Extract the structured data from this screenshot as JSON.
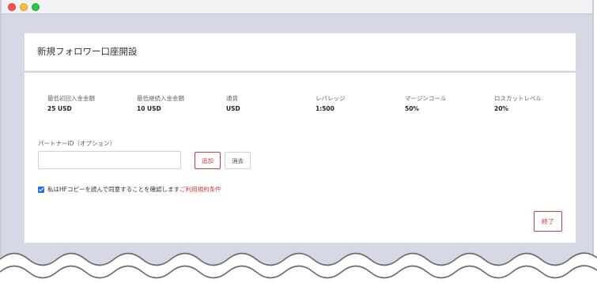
{
  "window": {
    "controls": [
      "close",
      "minimize",
      "maximize"
    ]
  },
  "card": {
    "title": "新規フォロワー口座開設"
  },
  "info": [
    {
      "label": "最低初回入金金額",
      "value": "25 USD"
    },
    {
      "label": "最低継続入金金額",
      "value": "10 USD"
    },
    {
      "label": "通貨",
      "value": "USD"
    },
    {
      "label": "レバレッジ",
      "value": "1:500"
    },
    {
      "label": "マージンコール",
      "value": "50%"
    },
    {
      "label": "ロスカットレベル",
      "value": "20%"
    }
  ],
  "partner": {
    "label": "パートナーID（オプション）",
    "value": "",
    "add_label": "追加",
    "clear_label": "消去"
  },
  "agreement": {
    "checked": true,
    "text": "私はHFコピーを読んで同意することを確認します",
    "link_text": "ご利用規約条件"
  },
  "actions": {
    "finish_label": "終了"
  },
  "colors": {
    "accent": "#d03b3b",
    "checkbox": "#1f6feb",
    "background": "#d7d8e6"
  }
}
